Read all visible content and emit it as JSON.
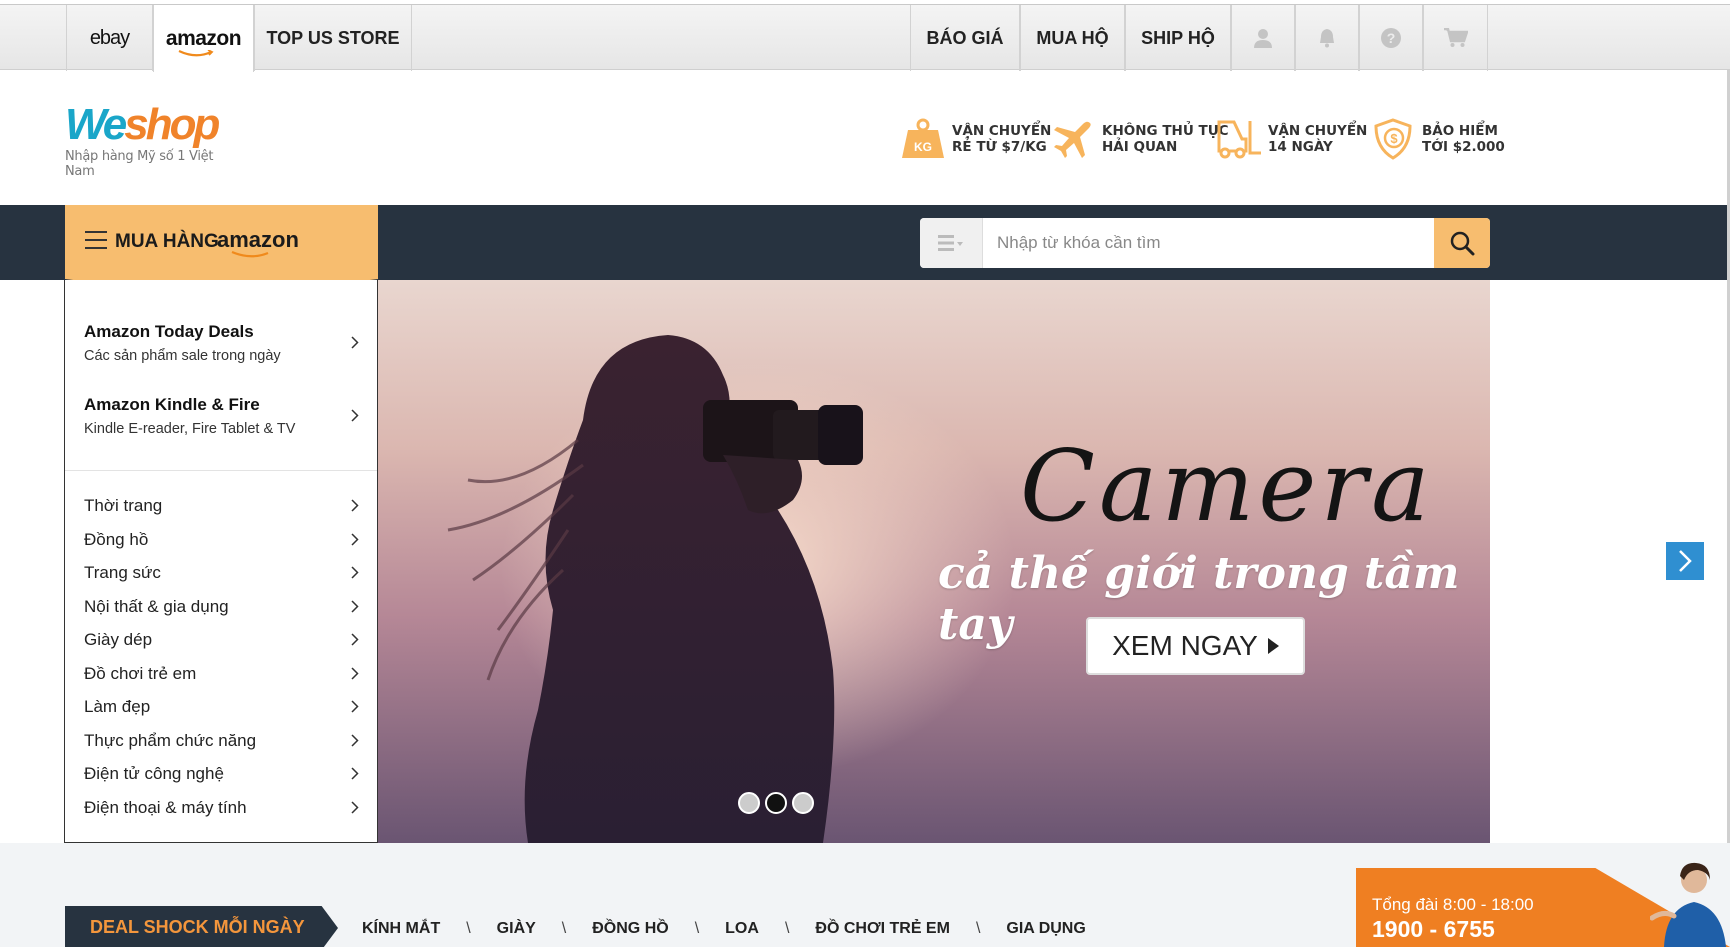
{
  "topnav": {
    "left_tabs": {
      "ebay": "ebay",
      "amazon": "amazon",
      "top_us_store": "TOP US STORE"
    },
    "right_tabs": {
      "bao_gia": "BÁO GIÁ",
      "mua_ho": "MUA HỘ",
      "ship_ho": "SHIP HỘ"
    },
    "icons": [
      "user-icon",
      "bell-icon",
      "help-icon",
      "cart-icon"
    ],
    "active_tab": "amazon"
  },
  "brand": {
    "name_we": "We",
    "name_shop": "shop",
    "tagline": "Nhập hàng Mỹ số 1 Việt Nam"
  },
  "features": [
    {
      "icon": "weight-kg-icon",
      "line1": "VẬN CHUYỂN",
      "line2": "RẺ TỪ $7/KG",
      "badge": "KG"
    },
    {
      "icon": "airplane-icon",
      "line1": "KHÔNG THỦ TỤC",
      "line2": "HẢI QUAN"
    },
    {
      "icon": "forklift-icon",
      "line1": "VẬN CHUYỂN",
      "line2": "14 NGÀY"
    },
    {
      "icon": "shield-dollar-icon",
      "line1": "BẢO HIỂM",
      "line2": "TỚI $2.000"
    }
  ],
  "menu_head": {
    "label": "MUA HÀNG",
    "store": "amazon"
  },
  "search": {
    "placeholder": "Nhập từ khóa cần tìm",
    "value": ""
  },
  "sidemenu": {
    "featured": [
      {
        "title": "Amazon Today Deals",
        "subtitle": "Các sản phẩm sale trong ngày"
      },
      {
        "title": "Amazon Kindle & Fire",
        "subtitle": "Kindle E-reader, Fire Tablet & TV"
      }
    ],
    "categories": [
      "Thời trang",
      "Đồng hồ",
      "Trang sức",
      "Nội thất & gia dụng",
      "Giày dép",
      "Đồ chơi trẻ em",
      "Làm đẹp",
      "Thực phẩm chức năng",
      "Điện tử công nghệ",
      "Điện thoại & máy tính"
    ]
  },
  "banner": {
    "title": "Camera",
    "subtitle": "cả thế giới trong tầm tay",
    "cta": "XEM NGAY",
    "slide_count": 3,
    "active_slide": 2
  },
  "deals": {
    "tab_label": "DEAL SHOCK MỖI NGÀY",
    "links": [
      "KÍNH MẮT",
      "GIÀY",
      "ĐỒNG HỒ",
      "LOA",
      "ĐỒ CHƠI TRẺ EM",
      "GIA DỤNG"
    ],
    "separator": "\\"
  },
  "hotline": {
    "hours": "Tổng đài 8:00 - 18:00",
    "number": "1900 - 6755"
  },
  "colors": {
    "accent_orange": "#f7bd6f",
    "dark_bar": "#273340",
    "hotline_orange": "#ef7f22",
    "brand_blue": "#1aa6c9",
    "brand_orange": "#f0832a",
    "arrow_blue": "#2f8fd1"
  }
}
